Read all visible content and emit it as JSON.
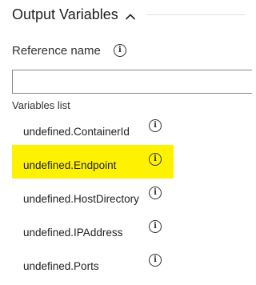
{
  "section": {
    "title": "Output Variables",
    "expanded": true
  },
  "reference": {
    "label": "Reference name",
    "value": "",
    "placeholder": ""
  },
  "variables": {
    "label": "Variables list",
    "items": [
      {
        "name": "undefined.ContainerId",
        "highlighted": false
      },
      {
        "name": "undefined.Endpoint",
        "highlighted": true
      },
      {
        "name": "undefined.HostDirectory",
        "highlighted": false
      },
      {
        "name": "undefined.IPAddress",
        "highlighted": false
      },
      {
        "name": "undefined.Ports",
        "highlighted": false
      }
    ]
  },
  "icons": {
    "info": "info-icon",
    "collapse": "chevron-up-icon"
  },
  "colors": {
    "highlight": "#fff200"
  }
}
